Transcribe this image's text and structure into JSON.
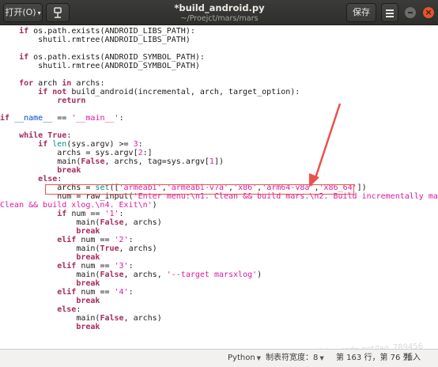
{
  "header": {
    "open_label": "打开(O)",
    "title": "*build_android.py",
    "subtitle": "~/Proejct/mars/mars",
    "save_label": "保存(S)",
    "close_glyph": "×"
  },
  "code_lines": [
    [
      [
        "pl",
        "    "
      ],
      [
        "kw",
        "if"
      ],
      [
        "pl",
        " os.path.exists(ANDROID_LIBS_PATH):"
      ]
    ],
    [
      [
        "pl",
        "        shutil.rmtree(ANDROID_LIBS_PATH)"
      ]
    ],
    [],
    [
      [
        "pl",
        "    "
      ],
      [
        "kw",
        "if"
      ],
      [
        "pl",
        " os.path.exists(ANDROID_SYMBOL_PATH):"
      ]
    ],
    [
      [
        "pl",
        "        shutil.rmtree(ANDROID_SYMBOL_PATH)"
      ]
    ],
    [],
    [
      [
        "pl",
        "    "
      ],
      [
        "kw",
        "for"
      ],
      [
        "pl",
        " arch "
      ],
      [
        "kw",
        "in"
      ],
      [
        "pl",
        " archs:"
      ]
    ],
    [
      [
        "pl",
        "        "
      ],
      [
        "kw",
        "if not"
      ],
      [
        "pl",
        " build_android(incremental, arch, target_option):"
      ]
    ],
    [
      [
        "pl",
        "            "
      ],
      [
        "kw",
        "return"
      ]
    ],
    [],
    [
      [
        "kw",
        "if"
      ],
      [
        "pl",
        " "
      ],
      [
        "dunder",
        "__name__"
      ],
      [
        "pl",
        " == "
      ],
      [
        "str",
        "'__main__'"
      ],
      [
        "pl",
        ":"
      ]
    ],
    [],
    [
      [
        "pl",
        "    "
      ],
      [
        "kw",
        "while"
      ],
      [
        "pl",
        " "
      ],
      [
        "kw",
        "True"
      ],
      [
        "pl",
        ":"
      ]
    ],
    [
      [
        "pl",
        "        "
      ],
      [
        "kw",
        "if"
      ],
      [
        "pl",
        " "
      ],
      [
        "bi",
        "len"
      ],
      [
        "pl",
        "(sys.argv) >= "
      ],
      [
        "num",
        "3"
      ],
      [
        "pl",
        ":"
      ]
    ],
    [
      [
        "pl",
        "            archs = sys.argv["
      ],
      [
        "num",
        "2"
      ],
      [
        "pl",
        ":]"
      ]
    ],
    [
      [
        "pl",
        "            main("
      ],
      [
        "kw",
        "False"
      ],
      [
        "pl",
        ", archs, tag=sys.argv["
      ],
      [
        "num",
        "1"
      ],
      [
        "pl",
        "])"
      ]
    ],
    [
      [
        "pl",
        "            "
      ],
      [
        "kw",
        "break"
      ]
    ],
    [
      [
        "pl",
        "        "
      ],
      [
        "kw",
        "else"
      ],
      [
        "pl",
        ":"
      ]
    ],
    [
      [
        "pl",
        "            archs = "
      ],
      [
        "bi",
        "set"
      ],
      [
        "pl",
        "(["
      ],
      [
        "str",
        "'armeabi'"
      ],
      [
        "pl",
        ","
      ],
      [
        "str",
        "'armeabi-v7a'"
      ],
      [
        "pl",
        ","
      ],
      [
        "str",
        "'x86'"
      ],
      [
        "pl",
        ","
      ],
      [
        "str",
        "'arm64-v8a'"
      ],
      [
        "pl",
        ","
      ],
      [
        "str",
        "'x86_64'"
      ],
      [
        "pl",
        "])"
      ]
    ],
    [
      [
        "pl",
        "            num = raw_input("
      ],
      [
        "str",
        "'Enter menu:\\n1. Clean && build mars.\\n2. Build incrementally mars.\\n3."
      ]
    ],
    [
      [
        "str",
        "Clean && build xlog.\\n4. Exit\\n'"
      ],
      [
        "pl",
        ")"
      ]
    ],
    [
      [
        "pl",
        "            "
      ],
      [
        "kw",
        "if"
      ],
      [
        "pl",
        " num == "
      ],
      [
        "str",
        "'1'"
      ],
      [
        "pl",
        ":"
      ]
    ],
    [
      [
        "pl",
        "                main("
      ],
      [
        "kw",
        "False"
      ],
      [
        "pl",
        ", archs)"
      ]
    ],
    [
      [
        "pl",
        "                "
      ],
      [
        "kw",
        "break"
      ]
    ],
    [
      [
        "pl",
        "            "
      ],
      [
        "kw",
        "elif"
      ],
      [
        "pl",
        " num == "
      ],
      [
        "str",
        "'2'"
      ],
      [
        "pl",
        ":"
      ]
    ],
    [
      [
        "pl",
        "                main("
      ],
      [
        "kw",
        "True"
      ],
      [
        "pl",
        ", archs)"
      ]
    ],
    [
      [
        "pl",
        "                "
      ],
      [
        "kw",
        "break"
      ]
    ],
    [
      [
        "pl",
        "            "
      ],
      [
        "kw",
        "elif"
      ],
      [
        "pl",
        " num == "
      ],
      [
        "str",
        "'3'"
      ],
      [
        "pl",
        ":"
      ]
    ],
    [
      [
        "pl",
        "                main("
      ],
      [
        "kw",
        "False"
      ],
      [
        "pl",
        ", archs, "
      ],
      [
        "str",
        "'--target marsxlog'"
      ],
      [
        "pl",
        ")"
      ]
    ],
    [
      [
        "pl",
        "                "
      ],
      [
        "kw",
        "break"
      ]
    ],
    [
      [
        "pl",
        "            "
      ],
      [
        "kw",
        "elif"
      ],
      [
        "pl",
        " num == "
      ],
      [
        "str",
        "'4'"
      ],
      [
        "pl",
        ":"
      ]
    ],
    [
      [
        "pl",
        "                "
      ],
      [
        "kw",
        "break"
      ]
    ],
    [
      [
        "pl",
        "            "
      ],
      [
        "kw",
        "else"
      ],
      [
        "pl",
        ":"
      ]
    ],
    [
      [
        "pl",
        "                main("
      ],
      [
        "kw",
        "False"
      ],
      [
        "pl",
        ", archs)"
      ]
    ],
    [
      [
        "pl",
        "                "
      ],
      [
        "kw",
        "break"
      ]
    ]
  ],
  "watermark": "https://blog.csdn.net/lao_789456",
  "statusbar": {
    "language": "Python",
    "tab_width": "制表符宽度：8",
    "position": "第 163 行，第 76 列",
    "mode": "插入"
  },
  "colors": {
    "keyword": "#a52a5f",
    "string": "#d8199e",
    "builtin": "#008b8b",
    "annotation": "#e8534a"
  },
  "icons": [
    "pin-icon",
    "hamburger-menu-icon",
    "minimize-icon",
    "close-icon",
    "dropdown-caret-icon",
    "red-arrow"
  ]
}
